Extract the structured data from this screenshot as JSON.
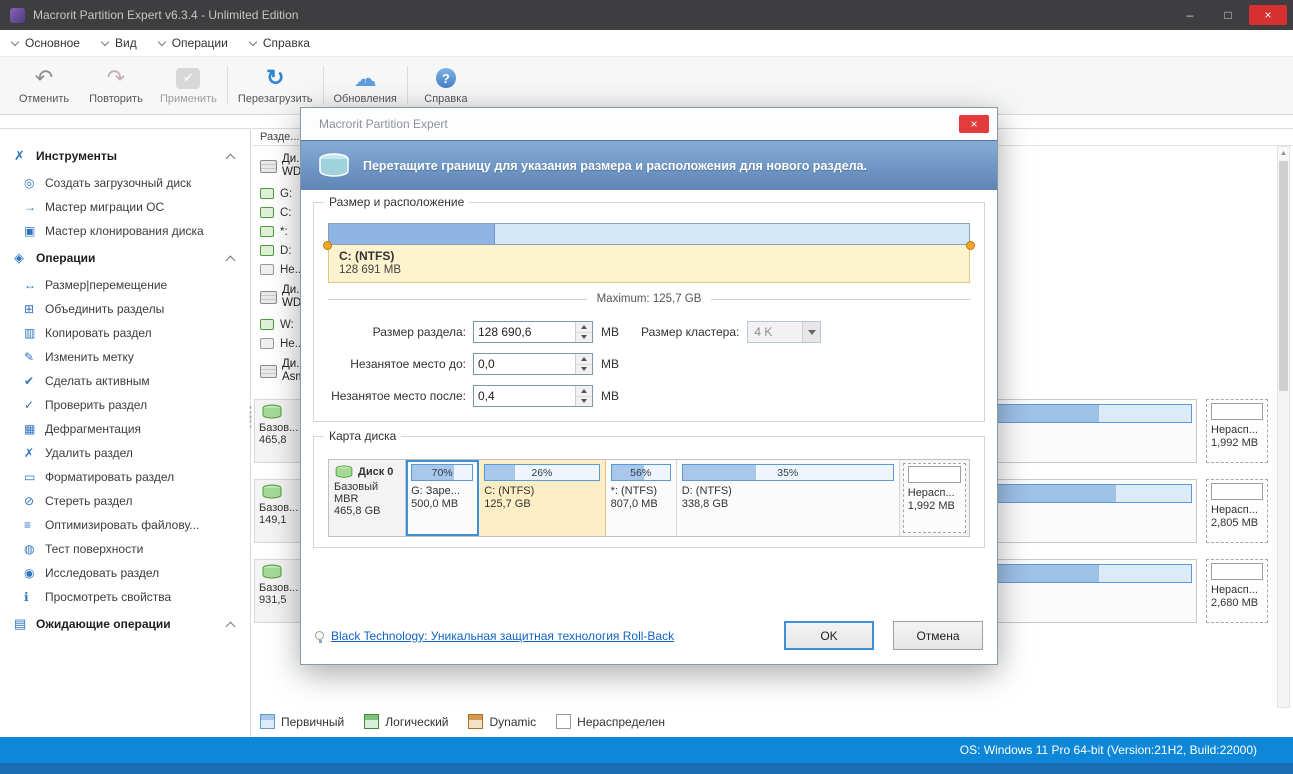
{
  "window": {
    "title": "Macrorit Partition Expert v6.3.4 - Unlimited Edition",
    "controls": {
      "minimize": "–",
      "maximize": "□",
      "close": "×"
    }
  },
  "menu": {
    "items": [
      {
        "label": "Основное"
      },
      {
        "label": "Вид"
      },
      {
        "label": "Операции"
      },
      {
        "label": "Справка"
      }
    ]
  },
  "toolbar": {
    "buttons": [
      {
        "label": "Отменить",
        "icon": "undo-icon",
        "glyph": "↶"
      },
      {
        "label": "Повторить",
        "icon": "redo-icon",
        "glyph": "↷"
      },
      {
        "label": "Применить",
        "icon": "apply-icon",
        "glyph": "✔"
      },
      {
        "label": "Перезагрузить",
        "icon": "reload-icon",
        "glyph": "↻"
      },
      {
        "label": "Обновления",
        "icon": "updates-icon",
        "glyph": "☁"
      },
      {
        "label": "Справка",
        "icon": "help-icon",
        "glyph": "?"
      }
    ]
  },
  "sidebar": {
    "sections": [
      {
        "title": "Инструменты",
        "icon": "tools-icon",
        "glyph": "✗",
        "items": [
          {
            "label": "Создать загрузочный диск",
            "icon": "bootdisk-icon",
            "glyph": "◎"
          },
          {
            "label": "Мастер миграции ОС",
            "icon": "os-migration-icon",
            "glyph": "→"
          },
          {
            "label": "Мастер клонирования диска",
            "icon": "clone-icon",
            "glyph": "▣"
          }
        ]
      },
      {
        "title": "Операции",
        "icon": "operations-icon",
        "glyph": "◈",
        "items": [
          {
            "label": "Размер|перемещение",
            "icon": "resize-icon",
            "glyph": "↔"
          },
          {
            "label": "Объединить разделы",
            "icon": "merge-icon",
            "glyph": "⊞"
          },
          {
            "label": "Копировать раздел",
            "icon": "copy-icon",
            "glyph": "▥"
          },
          {
            "label": "Изменить метку",
            "icon": "label-icon",
            "glyph": "✎"
          },
          {
            "label": "Сделать активным",
            "icon": "set-active-icon",
            "glyph": "✔"
          },
          {
            "label": "Проверить раздел",
            "icon": "check-partition-icon",
            "glyph": "✓"
          },
          {
            "label": "Дефрагментация",
            "icon": "defrag-icon",
            "glyph": "▦"
          },
          {
            "label": "Удалить раздел",
            "icon": "delete-icon",
            "glyph": "✗"
          },
          {
            "label": "Форматировать раздел",
            "icon": "format-icon",
            "glyph": "▭"
          },
          {
            "label": "Стереть раздел",
            "icon": "wipe-icon",
            "glyph": "⊘"
          },
          {
            "label": "Оптимизировать файлову...",
            "icon": "optimize-icon",
            "glyph": "≡"
          },
          {
            "label": "Тест поверхности",
            "icon": "surface-test-icon",
            "glyph": "◍"
          },
          {
            "label": "Исследовать раздел",
            "icon": "explore-icon",
            "glyph": "◉"
          },
          {
            "label": "Просмотреть свойства",
            "icon": "properties-icon",
            "glyph": "ℹ"
          }
        ]
      },
      {
        "title": "Ожидающие операции",
        "icon": "pending-operations-icon",
        "glyph": "▤",
        "items": []
      }
    ]
  },
  "table": {
    "header": "Разде...",
    "rows": [
      {
        "kind": "disk",
        "line1": "Ди...",
        "line2": "WD..."
      },
      {
        "kind": "part",
        "label": "G:"
      },
      {
        "kind": "part",
        "label": "C:"
      },
      {
        "kind": "part",
        "label": "*:"
      },
      {
        "kind": "part",
        "label": "D:"
      },
      {
        "kind": "part",
        "label": "Не..."
      },
      {
        "kind": "disk",
        "line1": "Ди...",
        "line2": "WD..."
      },
      {
        "kind": "part",
        "label": "W:"
      },
      {
        "kind": "part",
        "label": "Не..."
      },
      {
        "kind": "disk",
        "line1": "Ди...",
        "line2": "Asm..."
      }
    ]
  },
  "disk_panels": [
    {
      "type": "Базов...",
      "size": "465,8",
      "bar_fill": 89,
      "unalloc_label": "Нерасп...",
      "unalloc_size": "1,992 MB"
    },
    {
      "type": "Базов...",
      "size": "149,1",
      "bar_fill": 91,
      "unalloc_label": "Нерасп...",
      "unalloc_size": "2,805 MB"
    },
    {
      "type": "Базов...",
      "size": "931,5",
      "bar_fill": 89,
      "unalloc_label": "Нерасп...",
      "unalloc_size": "2,680 MB"
    }
  ],
  "legend": {
    "items": [
      {
        "label": "Первичный",
        "color": "#5b9bd5"
      },
      {
        "label": "Логический",
        "color": "#4ba446"
      },
      {
        "label": "Dynamic",
        "color": "#c07b3a"
      },
      {
        "label": "Нераспределен",
        "color": "#ffffff"
      }
    ]
  },
  "statusbar": {
    "os_info": "OS: Windows 11 Pro 64-bit (Version:21H2, Build:22000)"
  },
  "dialog": {
    "title": "Macrorit Partition Expert",
    "close": "×",
    "banner": "Перетащите границу для указания размера и расположения для нового раздела.",
    "size_group": {
      "title": "Размер и расположение",
      "slider": {
        "label": "C: (NTFS)",
        "size": "128 691 MB",
        "used_percent": 26
      },
      "maximum": "Maximum: 125,7 GB",
      "fields": [
        {
          "label": "Размер раздела:",
          "value": "128 690,6",
          "unit": "MB"
        },
        {
          "label": "Незанятое место до:",
          "value": "0,0",
          "unit": "MB"
        },
        {
          "label": "Незанятое место после:",
          "value": "0,4",
          "unit": "MB"
        }
      ],
      "cluster": {
        "label": "Размер кластера:",
        "value": "4 K"
      }
    },
    "map_group": {
      "title": "Карта диска",
      "disk": {
        "name": "Диск 0",
        "type": "Базовый MBR",
        "size": "465,8 GB"
      },
      "partitions": [
        {
          "name": "G: Заре...",
          "size": "500,0 MB",
          "percent": "70%",
          "fill": 70,
          "state": "selected"
        },
        {
          "name": "C: (NTFS)",
          "size": "125,7 GB",
          "percent": "26%",
          "fill": 26,
          "state": "highlight"
        },
        {
          "name": "*: (NTFS)",
          "size": "807,0 MB",
          "percent": "56%",
          "fill": 56,
          "state": "normal"
        },
        {
          "name": "D: (NTFS)",
          "size": "338,8 GB",
          "percent": "35%",
          "fill": 35,
          "state": "normal"
        },
        {
          "name": "Нерасп...",
          "size": "1,992 MB",
          "state": "unallocated"
        }
      ]
    },
    "link": "Black Technology: Уникальная защитная технология Roll-Back",
    "buttons": {
      "ok": "OK",
      "cancel": "Отмена"
    }
  }
}
